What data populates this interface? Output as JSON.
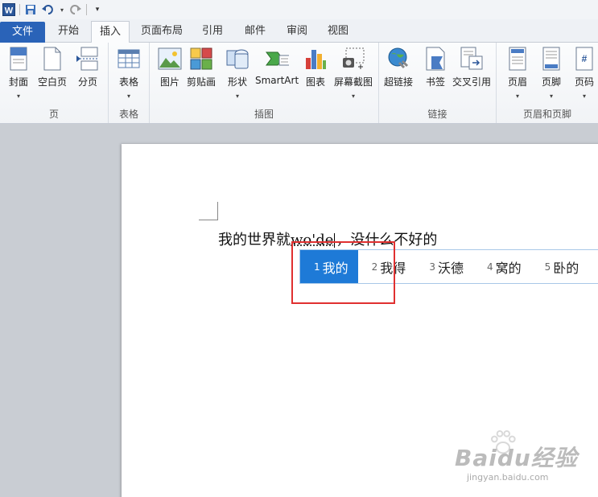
{
  "qat": {
    "save": "保存",
    "undo": "撤销",
    "redo": "恢复",
    "customize": "自定义快速访问工具栏"
  },
  "tabs": [
    "文件",
    "开始",
    "插入",
    "页面布局",
    "引用",
    "邮件",
    "审阅",
    "视图"
  ],
  "active_tab": "插入",
  "ribbon": {
    "groups": [
      {
        "label": "页",
        "buttons": [
          "封面",
          "空白页",
          "分页"
        ]
      },
      {
        "label": "表格",
        "buttons": [
          "表格"
        ]
      },
      {
        "label": "插图",
        "buttons": [
          "图片",
          "剪贴画",
          "形状",
          "SmartArt",
          "图表",
          "屏幕截图"
        ]
      },
      {
        "label": "链接",
        "buttons": [
          "超链接",
          "书签",
          "交叉引用"
        ]
      },
      {
        "label": "页眉和页脚",
        "buttons": [
          "页眉",
          "页脚",
          "页码"
        ]
      }
    ]
  },
  "document": {
    "text_before": "我的世界就",
    "composition": "wo'de",
    "text_after": "，没什么不好的"
  },
  "ime": {
    "candidates": [
      {
        "num": "1",
        "text": "我的"
      },
      {
        "num": "2",
        "text": "我得"
      },
      {
        "num": "3",
        "text": "沃德"
      },
      {
        "num": "4",
        "text": "窝的"
      },
      {
        "num": "5",
        "text": "卧的"
      }
    ],
    "selected_index": 0
  },
  "watermark": {
    "brand": "Baidu经验",
    "url": "jingyan.baidu.com"
  },
  "colors": {
    "accent": "#1e7ad7",
    "file_tab": "#2a63b8",
    "highlight": "#e03030"
  }
}
